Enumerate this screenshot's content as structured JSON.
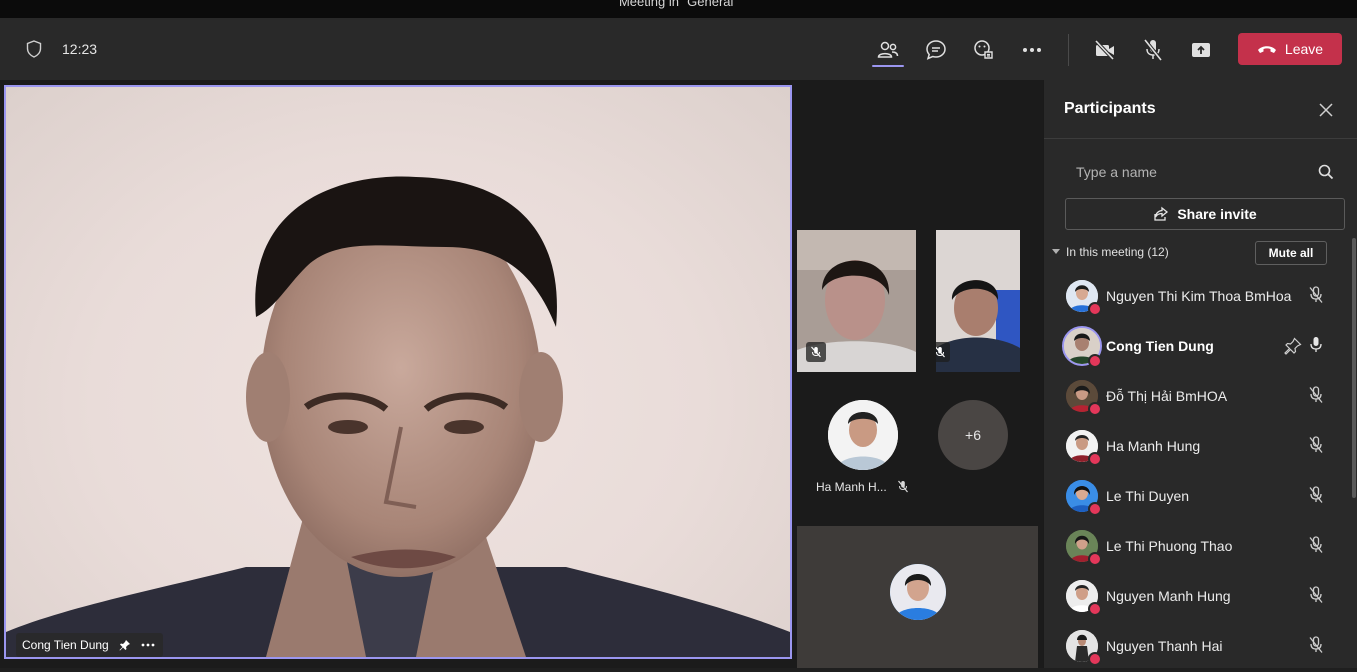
{
  "window": {
    "title": "Meeting in \"General\""
  },
  "toolbar": {
    "time": "12:23",
    "leave_label": "Leave",
    "icons": [
      "shield-icon",
      "people-icon",
      "chat-icon",
      "reactions-icon",
      "more-icon",
      "camera-off-icon",
      "mic-off-icon",
      "share-tray-icon",
      "phone-hangup-icon"
    ]
  },
  "stage": {
    "main": {
      "name": "Cong Tien Dung"
    },
    "tile_name": "Ha Manh H...",
    "overflow": "+6"
  },
  "panel": {
    "title": "Participants",
    "search_placeholder": "Type a name",
    "share_invite": "Share invite",
    "section_label": "In this meeting (12)",
    "mute_all": "Mute all",
    "participants": [
      {
        "name": "Nguyen Thi Kim Thoa BmHoa",
        "mic": "muted"
      },
      {
        "name": "Cong Tien Dung",
        "mic": "unmuted",
        "pinned": true
      },
      {
        "name": "Đỗ Thị Hải BmHOA",
        "mic": "muted"
      },
      {
        "name": "Ha Manh Hung",
        "mic": "muted"
      },
      {
        "name": "Le Thi Duyen",
        "mic": "muted"
      },
      {
        "name": "Le Thi Phuong Thao",
        "mic": "muted"
      },
      {
        "name": "Nguyen Manh Hung",
        "mic": "muted"
      },
      {
        "name": "Nguyen Thanh Hai",
        "mic": "muted"
      }
    ]
  },
  "colors": {
    "accent": "#9b96f0",
    "leave": "#c4314b",
    "presence_dot": "#e3375a"
  }
}
